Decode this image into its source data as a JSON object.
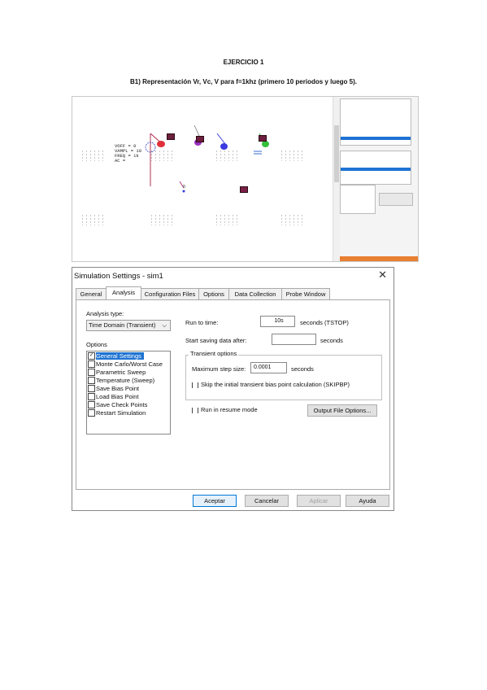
{
  "document": {
    "title": "EJERCICIO 1",
    "subtitle": "B1) Representación Vr, Vc, V para f=1khz (primero 10 periodos y luego 5)."
  },
  "schematic": {
    "source_params": "VOFF = 0\nVAMPL = 10\nFREQ = 1k\nAC =",
    "ground_label": "0",
    "colors": {
      "probe_red": "#e0303a",
      "probe_blue": "#3a3ae0",
      "probe_green": "#35c03a",
      "panel_orange": "#e87f32",
      "selection_blue": "#1e73d2"
    }
  },
  "dialog": {
    "title": "Simulation Settings - sim1",
    "close_icon": "close-icon",
    "tabs": [
      "General",
      "Analysis",
      "Configuration Files",
      "Options",
      "Data Collection",
      "Probe Window"
    ],
    "active_tab": "Analysis",
    "analysis_type_label": "Analysis type:",
    "analysis_type_value": "Time Domain (Transient)",
    "options_label": "Options",
    "options": [
      {
        "label": "General Settings",
        "checked": true,
        "selected": true
      },
      {
        "label": "Monte Carlo/Worst Case",
        "checked": false,
        "selected": false
      },
      {
        "label": "Parametric Sweep",
        "checked": false,
        "selected": false
      },
      {
        "label": "Temperature (Sweep)",
        "checked": false,
        "selected": false
      },
      {
        "label": "Save Bias Point",
        "checked": false,
        "selected": false
      },
      {
        "label": "Load Bias Point",
        "checked": false,
        "selected": false
      },
      {
        "label": "Save Check Points",
        "checked": false,
        "selected": false
      },
      {
        "label": "Restart Simulation",
        "checked": false,
        "selected": false
      }
    ],
    "run_to_time_label": "Run to time:",
    "run_to_time_value": "10s",
    "run_to_time_units": "seconds (TSTOP)",
    "start_saving_label": "Start saving data after:",
    "start_saving_value": "",
    "start_saving_units": "seconds",
    "transient_group_title": "Transient options",
    "max_step_label": "Maximum step size:",
    "max_step_value": "0.0001",
    "max_step_units": "seconds",
    "skip_bias_label": "Skip the initial transient bias point calculation (SKIPBP)",
    "run_resume_label": "Run in resume mode",
    "output_file_button": "Output File Options...",
    "buttons": {
      "accept": "Aceptar",
      "cancel": "Cancelar",
      "apply": "Aplicar",
      "help": "Ayuda"
    }
  }
}
